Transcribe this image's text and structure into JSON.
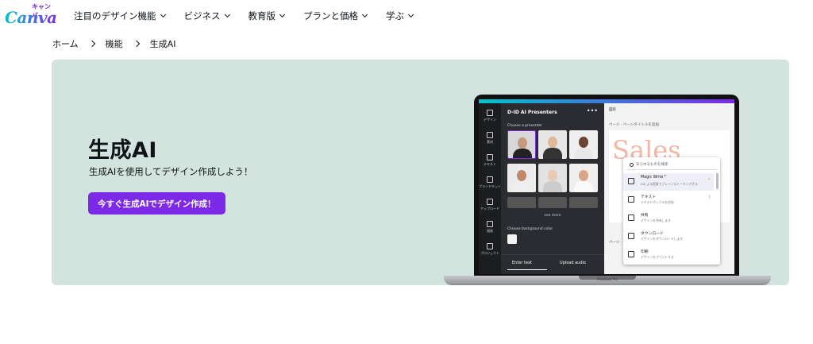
{
  "brand": {
    "logo": "Canva",
    "logo_kana": "キャンバ",
    "accent": "#7d2ae8"
  },
  "nav": {
    "items": [
      {
        "label": "注目のデザイン機能"
      },
      {
        "label": "ビジネス"
      },
      {
        "label": "教育版"
      },
      {
        "label": "プランと価格"
      },
      {
        "label": "学ぶ"
      }
    ]
  },
  "breadcrumb": [
    "ホーム",
    "機能",
    "生成AI"
  ],
  "hero": {
    "title": "生成AI",
    "subtitle": "生成AIを使用してデザイン作成しよう！",
    "cta": "今すぐ生成AIでデザイン作成！",
    "bg_color": "#d3e3dd"
  },
  "mockup": {
    "laptop_label": "MacBook Pro",
    "sidebar": [
      "デザイン",
      "素材",
      "テキスト",
      "ブランドキット",
      "アップロード",
      "描画",
      "プロジェクト"
    ],
    "panel_title": "D-ID AI Presenters",
    "panel_menu": "•••",
    "choose_presenter": "Choose a presenter",
    "see_more": "see more",
    "choose_bg": "Choose background color",
    "tabs": [
      "Enter text",
      "Upload audio"
    ],
    "canvas_top": "図形",
    "page_title": "ページ - ページタイトルを追加",
    "slide_text": "Sales",
    "page2": "ページ - ペ",
    "search_placeholder": "あらゆるものを検索",
    "menu": [
      {
        "title": "Magic Write™",
        "desc": "AIによる提案でブレインストーミングする",
        "key": "✦"
      },
      {
        "title": "テキスト",
        "desc": "テキストボックスを追加",
        "key": "T"
      },
      {
        "title": "共有",
        "desc": "デザインを共有します",
        "key": ""
      },
      {
        "title": "ダウンロード",
        "desc": "デザインをダウンロードします",
        "key": ""
      },
      {
        "title": "印刷",
        "desc": "デザインをプリントする",
        "key": ""
      }
    ]
  }
}
